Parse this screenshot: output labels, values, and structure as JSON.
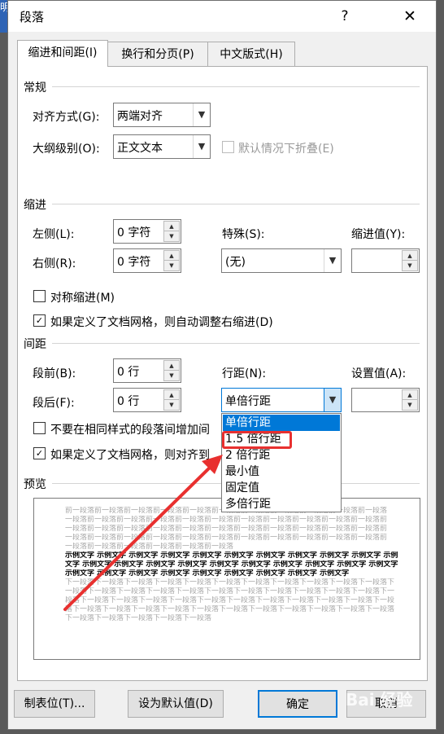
{
  "dialog": {
    "title": "段落",
    "help": "?",
    "close": "✕",
    "edge_text": "明"
  },
  "tabs": [
    {
      "label": "缩进和间距(I)"
    },
    {
      "label": "换行和分页(P)"
    },
    {
      "label": "中文版式(H)"
    }
  ],
  "general": {
    "header": "常规",
    "align_label": "对齐方式(G):",
    "align_value": "两端对齐",
    "outline_label": "大纲级别(O):",
    "outline_value": "正文文本",
    "collapse_label": "默认情况下折叠(E)"
  },
  "indent": {
    "header": "缩进",
    "left_label": "左侧(L):",
    "left_value": "0 字符",
    "right_label": "右侧(R):",
    "right_value": "0 字符",
    "special_label": "特殊(S):",
    "special_value": "(无)",
    "indent_value_label": "缩进值(Y):",
    "mirror_label": "对称缩进(M)",
    "auto_adjust_label": "如果定义了文档网格，则自动调整右缩进(D)"
  },
  "spacing": {
    "header": "间距",
    "before_label": "段前(B):",
    "before_value": "0 行",
    "after_label": "段后(F):",
    "after_value": "0 行",
    "line_label": "行距(N):",
    "line_value": "单倍行距",
    "set_value_label": "设置值(A):",
    "no_space_label": "不要在相同样式的段落间增加间",
    "snap_grid_label": "如果定义了文档网格，则对齐到",
    "options": [
      "单倍行距",
      "1.5 倍行距",
      "2 倍行距",
      "最小值",
      "固定值",
      "多倍行距"
    ]
  },
  "preview": {
    "header": "预览",
    "prev_lines": [
      "前一段落前一段落前一段落前一段落前一段落前一段落前一段落前一段落前一段落前一段落前一段落",
      "一段落前一段落前一段落前一段落前一段落前一段落前一段落前一段落前一段落前一段落前一段落前",
      "一段落前一段落前一段落前一段落前一段落前一段落前一段落前一段落前一段落前一段落前一段落前",
      "一段落前一段落前一段落前一段落前一段落前一段落前一段落前一段落前一段落前一段落前一段落前",
      "一段落前一段落前一段落前一段落前一段落前一段落"
    ],
    "sample_lines": [
      "示例文字 示例文字 示例文字 示例文字 示例文字 示例文字 示例文字 示例文字 示例文字 示例文字 示例",
      "文字 示例文字 示例文字 示例文字 示例文字 示例文字 示例文字 示例文字 示例文字 示例文字 示例文字",
      "示例文字 示例文字 示例文字 示例文字 示例文字 示例文字 示例文字 示例文字 示例文字"
    ],
    "next_lines": [
      "下一段落下一段落下一段落下一段落下一段落下一段落下一段落下一段落下一段落下一段落下一段落下",
      "一段落下一段落下一段落下一段落下一段落下一段落下一段落下一段落下一段落下一段落下一段落下一",
      "段落下一段落下一段落下一段落下一段落下一段落下一段落下一段落下一段落下一段落下一段落下一段",
      "落下一段落下一段落下一段落下一段落下一段落下一段落下一段落下一段落下一段落下一段落下一段落",
      "下一段落下一段落下一段落下一段落下一段落"
    ]
  },
  "buttons": {
    "tabs": "制表位(T)...",
    "default": "设为默认值(D)",
    "ok": "确定",
    "cancel": "取消"
  },
  "watermark": "Bai 经验",
  "colors": {
    "accent": "#0078d7",
    "annotation_red": "#e8302f"
  }
}
